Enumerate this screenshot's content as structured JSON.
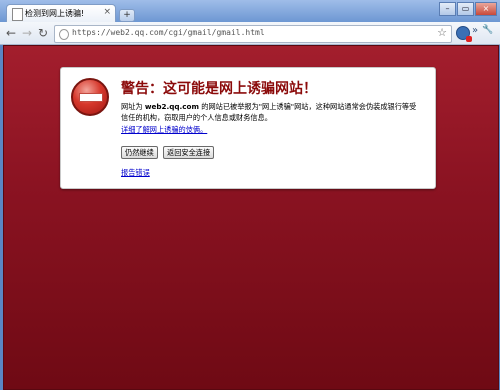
{
  "tab": {
    "title": "检测到网上诱骗!",
    "close": "×",
    "new_tab": "+"
  },
  "window_controls": {
    "minimize": "–",
    "maximize": "▭",
    "close": "×"
  },
  "toolbar": {
    "back": "←",
    "forward": "→",
    "reload": "↻",
    "url": "https://web2.qq.com/cgi/gmail/gmail.html",
    "star": "☆",
    "extensions_glyph": "»",
    "wrench": "🔧"
  },
  "warning": {
    "title": "警告：这可能是网上诱骗网站！",
    "text_prefix": "网址为 ",
    "domain": "web2.qq.com",
    "text_suffix": " 的网站已被举报为\"网上诱骗\"网站，这种网站通常会伪装成银行等受信任的机构，窃取用户的个人信息或财务信息。",
    "learn_more_link": "详细了解网上诱骗的伎俩。",
    "proceed_button": "仍然继续",
    "back_button": "返回安全连接",
    "report_link": "报告错误"
  },
  "colors": {
    "background_top": "#a31e2d",
    "background_bottom": "#6f0a14",
    "title_red": "#8b0a0a",
    "link": "#0000cc"
  }
}
